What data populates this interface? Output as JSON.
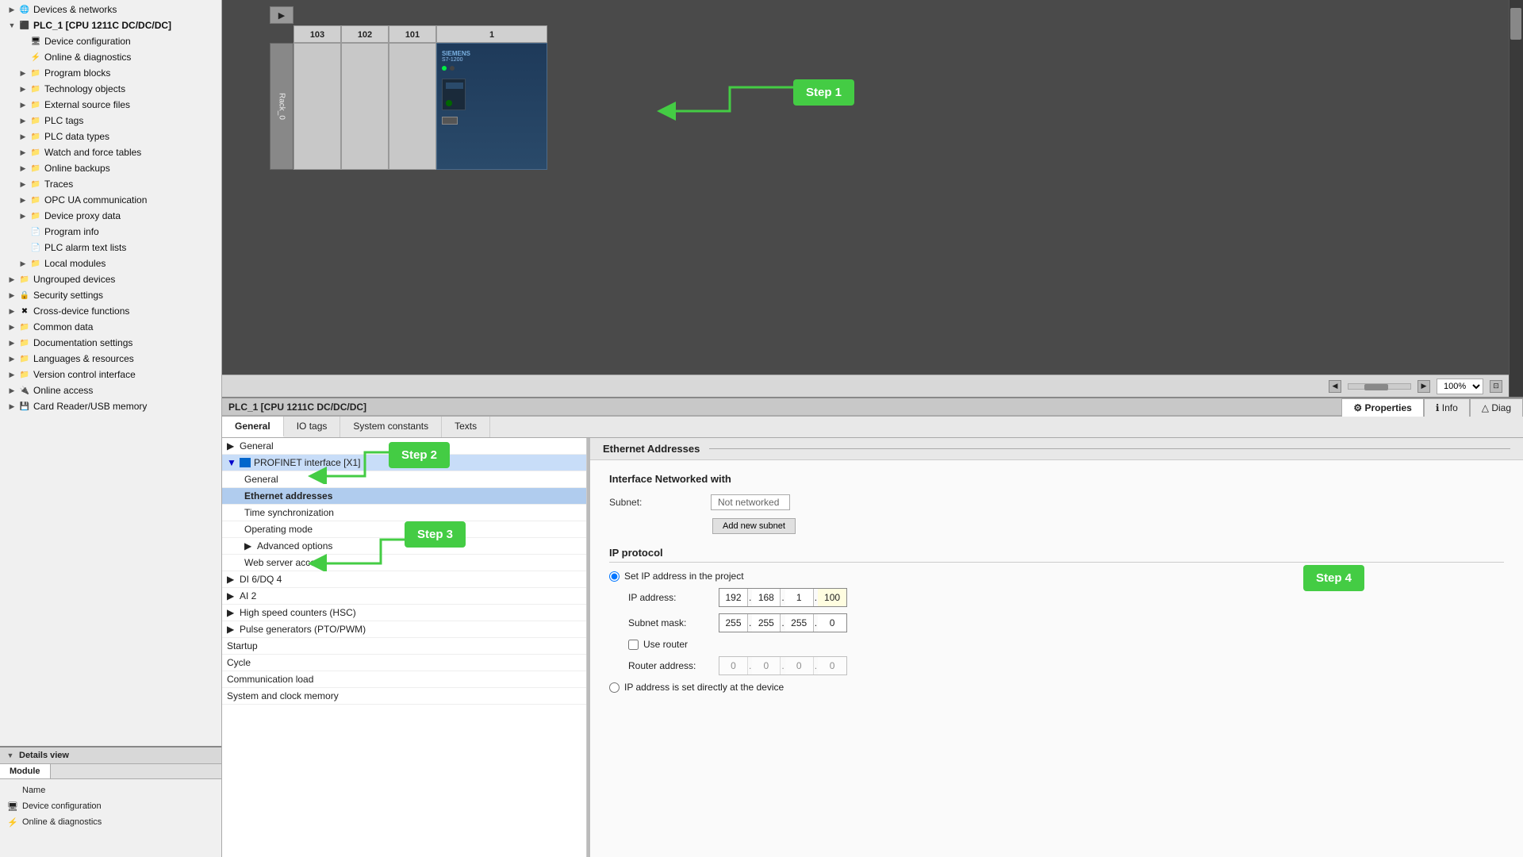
{
  "sidebar": {
    "items": [
      {
        "label": "Devices & networks",
        "level": 1,
        "expanded": false,
        "icon": "network"
      },
      {
        "label": "PLC_1 [CPU 1211C DC/DC/DC]",
        "level": 1,
        "expanded": true,
        "icon": "plc"
      },
      {
        "label": "Device configuration",
        "level": 2,
        "icon": "device"
      },
      {
        "label": "Online & diagnostics",
        "level": 2,
        "icon": "diagnostics"
      },
      {
        "label": "Program blocks",
        "level": 2,
        "icon": "folder"
      },
      {
        "label": "Technology objects",
        "level": 2,
        "icon": "folder"
      },
      {
        "label": "External source files",
        "level": 2,
        "icon": "folder"
      },
      {
        "label": "PLC tags",
        "level": 2,
        "icon": "folder"
      },
      {
        "label": "PLC data types",
        "level": 2,
        "icon": "folder"
      },
      {
        "label": "Watch and force tables",
        "level": 2,
        "icon": "folder"
      },
      {
        "label": "Online backups",
        "level": 2,
        "icon": "folder"
      },
      {
        "label": "Traces",
        "level": 2,
        "icon": "folder"
      },
      {
        "label": "OPC UA communication",
        "level": 2,
        "icon": "folder"
      },
      {
        "label": "Device proxy data",
        "level": 2,
        "icon": "folder"
      },
      {
        "label": "Program info",
        "level": 2,
        "icon": "doc"
      },
      {
        "label": "PLC alarm text lists",
        "level": 2,
        "icon": "doc"
      },
      {
        "label": "Local modules",
        "level": 2,
        "icon": "folder"
      },
      {
        "label": "Ungrouped devices",
        "level": 1,
        "icon": "folder"
      },
      {
        "label": "Security settings",
        "level": 1,
        "icon": "security"
      },
      {
        "label": "Cross-device functions",
        "level": 1,
        "icon": "cross"
      },
      {
        "label": "Common data",
        "level": 1,
        "icon": "folder"
      },
      {
        "label": "Documentation settings",
        "level": 1,
        "icon": "folder"
      },
      {
        "label": "Languages & resources",
        "level": 1,
        "icon": "folder"
      },
      {
        "label": "Version control interface",
        "level": 1,
        "icon": "folder"
      },
      {
        "label": "Online access",
        "level": 1,
        "icon": "online"
      },
      {
        "label": "Card Reader/USB memory",
        "level": 1,
        "icon": "card"
      }
    ]
  },
  "details_view": {
    "title": "Details view",
    "tab": "Module",
    "col_name": "Name",
    "rows": [
      {
        "name": "Device configuration",
        "icon": "device"
      },
      {
        "name": "Online & diagnostics",
        "icon": "diagnostics"
      }
    ]
  },
  "canvas": {
    "zoom_level": "100%",
    "rack_label": "Rack_0",
    "slot_numbers": [
      "103",
      "102",
      "101",
      "1"
    ],
    "step1": {
      "label": "Step 1"
    }
  },
  "panel": {
    "title": "PLC_1 [CPU 1211C DC/DC/DC]",
    "tabs": [
      {
        "label": "General",
        "active": true
      },
      {
        "label": "IO tags",
        "active": false
      },
      {
        "label": "System constants",
        "active": false
      },
      {
        "label": "Texts",
        "active": false
      }
    ],
    "right_tabs": [
      {
        "label": "Properties",
        "active": true,
        "icon": ""
      },
      {
        "label": "Info",
        "active": false,
        "icon": "ℹ"
      },
      {
        "label": "Diag",
        "active": false,
        "icon": ""
      }
    ],
    "config_tree": {
      "items": [
        {
          "label": "General",
          "level": 0,
          "expanded": false
        },
        {
          "label": "PROFINET interface [X1]",
          "level": 0,
          "expanded": true,
          "selected": true
        },
        {
          "label": "General",
          "level": 1
        },
        {
          "label": "Ethernet addresses",
          "level": 1,
          "selected": true
        },
        {
          "label": "Time synchronization",
          "level": 1
        },
        {
          "label": "Operating mode",
          "level": 1
        },
        {
          "label": "Advanced options",
          "level": 1,
          "expanded": false
        },
        {
          "label": "Web server access",
          "level": 1
        },
        {
          "label": "DI 6/DQ 4",
          "level": 0,
          "expanded": false
        },
        {
          "label": "AI 2",
          "level": 0,
          "expanded": false
        },
        {
          "label": "High speed counters (HSC)",
          "level": 0,
          "expanded": false
        },
        {
          "label": "Pulse generators (PTO/PWM)",
          "level": 0,
          "expanded": false
        },
        {
          "label": "Startup",
          "level": 0
        },
        {
          "label": "Cycle",
          "level": 0
        },
        {
          "label": "Communication load",
          "level": 0
        },
        {
          "label": "System and clock memory",
          "level": 0
        }
      ]
    },
    "properties": {
      "section_title": "Ethernet Addresses",
      "interface_label": "Interface Networked with",
      "subnet_label": "Subnet:",
      "subnet_value": "Not networked",
      "add_subnet_btn": "Add new subnet",
      "ip_protocol_label": "IP protocol",
      "set_ip_radio": "Set IP address in the project",
      "ip_address_label": "IP address:",
      "ip_octets": [
        "192",
        "168",
        "1",
        "100"
      ],
      "subnet_mask_label": "Subnet mask:",
      "subnet_octets": [
        "255",
        "255",
        "255",
        "0"
      ],
      "use_router_label": "Use router",
      "router_address_label": "Router address:",
      "router_octets": [
        "0",
        "0",
        "0",
        "0"
      ],
      "set_directly_radio": "IP address is set directly at the device"
    },
    "steps": {
      "step2": {
        "label": "Step 2"
      },
      "step3": {
        "label": "Step 3"
      },
      "step4": {
        "label": "Step 4"
      }
    }
  }
}
